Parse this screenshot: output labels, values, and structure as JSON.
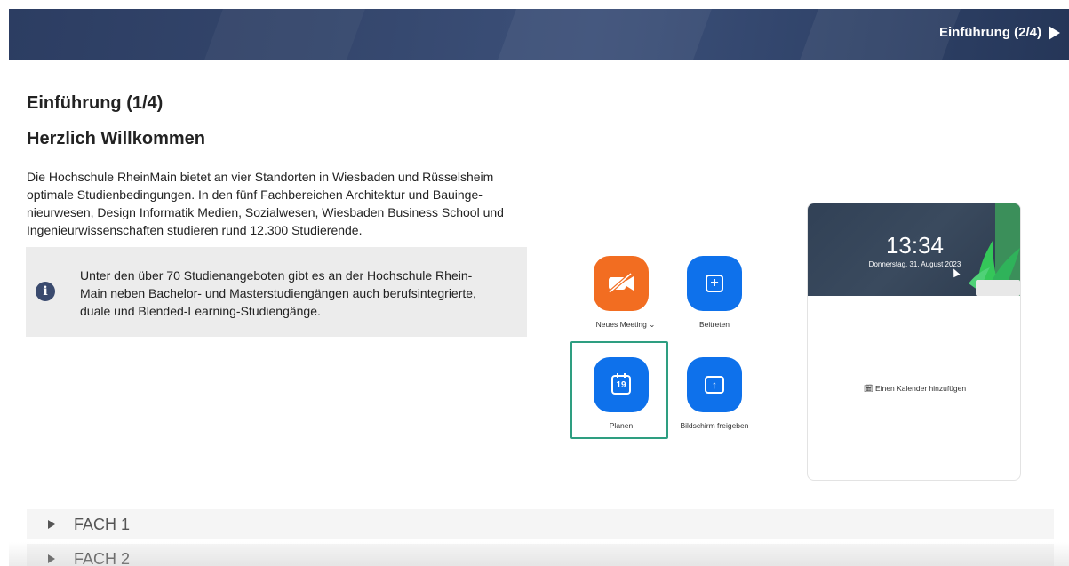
{
  "header": {
    "next_label": "Einführung (2/4)"
  },
  "page": {
    "title": "Einführung (1/4)",
    "section_title": "Herzlich Willkommen",
    "intro_lines": [
      "Die Hochschule RheinMain bietet an vier Standorten in Wiesbaden und Rüsselsheim",
      "optimale Studienbedingungen. In den fünf Fachbereichen Architektur und Bauinge-",
      "nieurwesen, Design Informatik Medien, Sozialwesen, Wiesbaden Business School und",
      "Ingenieurwissenschaften studieren rund 12.300 Studierende."
    ],
    "info_lines": [
      "Unter den über 70 Studienangeboten gibt es an der Hochschule Rhein-",
      "Main neben Bachelor- und Masterstudiengängen auch berufsintegrierte,",
      "duale und Blended-Learning-Studiengänge."
    ]
  },
  "zoom": {
    "buttons": [
      {
        "label": "Neues Meeting ⌄",
        "icon": "video-off-icon",
        "color": "#f26d21"
      },
      {
        "label": "Beitreten",
        "icon": "plus-icon",
        "glyph": "+",
        "color": "#0e71eb"
      },
      {
        "label": "Planen",
        "icon": "calendar-icon",
        "glyph": "19",
        "color": "#0e71eb",
        "highlighted": true
      },
      {
        "label": "Bildschirm freigeben",
        "icon": "share-screen-icon",
        "glyph": "↑",
        "color": "#0e71eb"
      }
    ],
    "calendar": {
      "time": "13:34",
      "date": "Donnerstag, 31. August 2023",
      "add_calendar": "Einen Kalender hinzufügen"
    }
  },
  "accordion": [
    {
      "label": "FACH 1"
    },
    {
      "label": "FACH 2"
    }
  ],
  "colors": {
    "banner": "#34466c",
    "highlight": "#2e9e81",
    "info_icon": "#3a4a6e",
    "zoom_blue": "#0e71eb",
    "zoom_orange": "#f26d21"
  }
}
